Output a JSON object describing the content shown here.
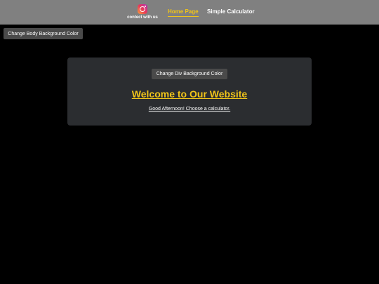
{
  "navbar": {
    "contact": {
      "icon": "instagram-icon",
      "label": "contect with us"
    },
    "links": [
      {
        "label": "Home Page",
        "active": true
      },
      {
        "label": "Simple Calculator",
        "active": false
      }
    ]
  },
  "body_button": {
    "label": "Change Body Background Color"
  },
  "panel": {
    "button_label": "Change Div Background Color",
    "heading": "Welcome to Our Website",
    "greeting": "Good Afternoon! Choose a calculator."
  },
  "colors": {
    "navbar": "#808080",
    "accent": "#f0c419",
    "page_background": "#000000",
    "panel_background": "#2b2d30",
    "button_background": "#4a4a4a"
  }
}
